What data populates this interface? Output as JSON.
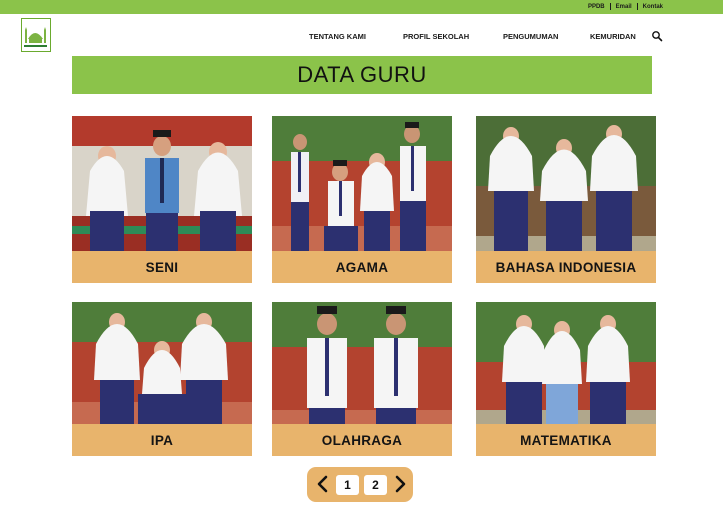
{
  "topbar": {
    "links": [
      "PPDB",
      "Email",
      "Kontak"
    ]
  },
  "nav": {
    "items": [
      "TENTANG KAMI",
      "PROFIL SEKOLAH",
      "PENGUMUMAN",
      "KEMURIDAN"
    ],
    "search_icon": "search-icon"
  },
  "page": {
    "title": "DATA GURU"
  },
  "cards": [
    {
      "label": "SENI"
    },
    {
      "label": "AGAMA"
    },
    {
      "label": "BAHASA INDONESIA"
    },
    {
      "label": "IPA"
    },
    {
      "label": "OLAHRAGA"
    },
    {
      "label": "MATEMATIKA"
    }
  ],
  "pagination": {
    "pages": [
      "1",
      "2"
    ],
    "prev_icon": "chevron-left-icon",
    "next_icon": "chevron-right-icon"
  },
  "colors": {
    "accent_green": "#8bc34a",
    "label_orange": "#e8b46c",
    "uniform_navy": "#2c3070"
  }
}
